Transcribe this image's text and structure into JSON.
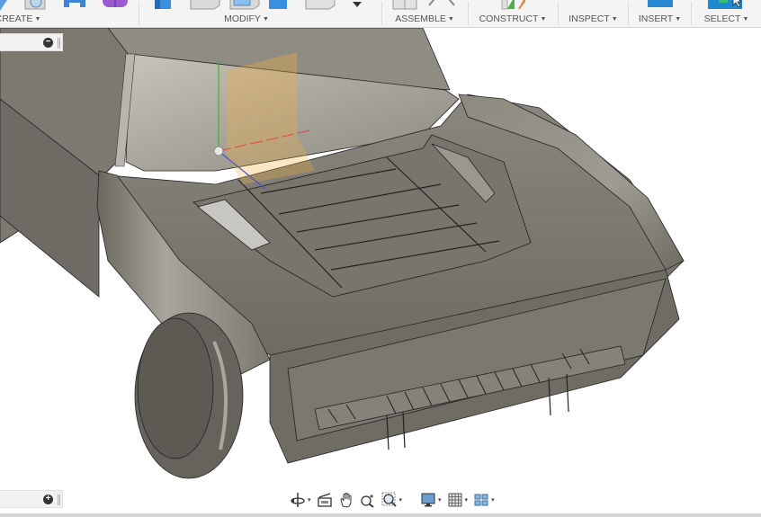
{
  "toolbar": {
    "groups": [
      {
        "id": "create",
        "label": "CREATE",
        "has_dropdown": true
      },
      {
        "id": "modify",
        "label": "MODIFY",
        "has_dropdown": true
      },
      {
        "id": "assemble",
        "label": "ASSEMBLE",
        "has_dropdown": true
      },
      {
        "id": "construct",
        "label": "CONSTRUCT",
        "has_dropdown": true
      },
      {
        "id": "inspect",
        "label": "INSPECT",
        "has_dropdown": true
      },
      {
        "id": "insert",
        "label": "INSERT",
        "has_dropdown": true
      },
      {
        "id": "select",
        "label": "SELECT",
        "has_dropdown": true
      }
    ],
    "caret": "▼"
  },
  "panels": {
    "browser": {
      "button_icon": "collapse-minus-icon",
      "button_glyph": "−"
    },
    "comments": {
      "button_icon": "expand-plus-icon",
      "button_glyph": "+"
    }
  },
  "viewport": {
    "model": "car-body-front-hood",
    "origin_axes": {
      "x_color": "#e05050",
      "y_color": "#40b040",
      "z_color": "#5050c0",
      "plane_color": "#f0b040"
    }
  },
  "navbar": {
    "items": [
      {
        "id": "orbit",
        "icon": "orbit-icon",
        "has_dropdown": true
      },
      {
        "id": "look-at",
        "icon": "look-at-icon",
        "has_dropdown": false
      },
      {
        "id": "pan",
        "icon": "pan-hand-icon",
        "has_dropdown": false
      },
      {
        "id": "zoom",
        "icon": "zoom-icon",
        "has_dropdown": false
      },
      {
        "id": "fit",
        "icon": "zoom-window-icon",
        "has_dropdown": true
      },
      {
        "id": "display-settings",
        "icon": "display-settings-icon",
        "has_dropdown": true
      },
      {
        "id": "grid-settings",
        "icon": "grid-icon",
        "has_dropdown": true
      },
      {
        "id": "viewports",
        "icon": "viewports-icon",
        "has_dropdown": true
      }
    ],
    "caret": "▾"
  },
  "colors": {
    "toolbar_bg": "#f4f4f4",
    "label_text": "#555555",
    "select_blue": "#1e88d0",
    "body_gray": "#7a776f"
  }
}
